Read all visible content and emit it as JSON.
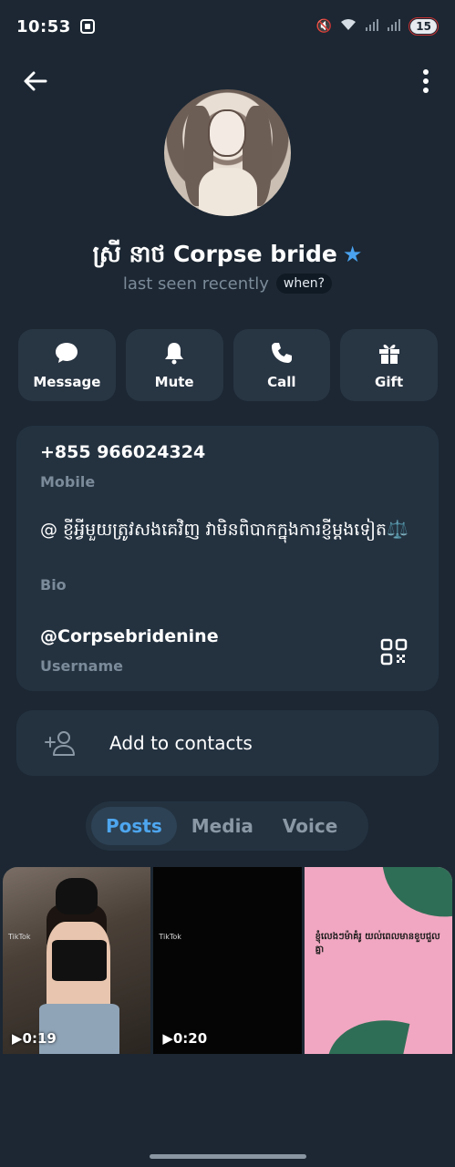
{
  "status_bar": {
    "time": "10:53",
    "battery": "15"
  },
  "profile": {
    "name": "ស្រី នាថ Corpse bride",
    "last_seen": "last seen recently",
    "when_badge": "when?"
  },
  "actions": [
    {
      "label": "Message",
      "icon": "message-icon"
    },
    {
      "label": "Mute",
      "icon": "bell-icon"
    },
    {
      "label": "Call",
      "icon": "phone-icon"
    },
    {
      "label": "Gift",
      "icon": "gift-icon"
    }
  ],
  "info": {
    "phone": "+855 966024324",
    "phone_label": "Mobile",
    "bio": "@ ខ្ញីអ្វីមួយត្រូវសងគេវិញ វាមិនពិបាកក្នុងការខ្ញីម្តងទៀត⚖️",
    "bio_label": "Bio",
    "username": "@Corpsebridenine",
    "username_label": "Username"
  },
  "add_contact": {
    "label": "Add to contacts"
  },
  "tabs": [
    {
      "label": "Posts",
      "active": true
    },
    {
      "label": "Media",
      "active": false
    },
    {
      "label": "Voice",
      "active": false
    }
  ],
  "media": [
    {
      "duration": "0:19",
      "tiktok": "TikTok"
    },
    {
      "duration": "0:20",
      "tiktok": "TikTok"
    },
    {
      "caption": "ខ្ញុំលេងៗម៉ាគំរូ​ យល់ពេលមានខួបជួលគ្នា"
    }
  ],
  "colors": {
    "background": "#1c2733",
    "card": "#243240",
    "accent": "#4ea6ef",
    "muted": "#7c8b99"
  }
}
